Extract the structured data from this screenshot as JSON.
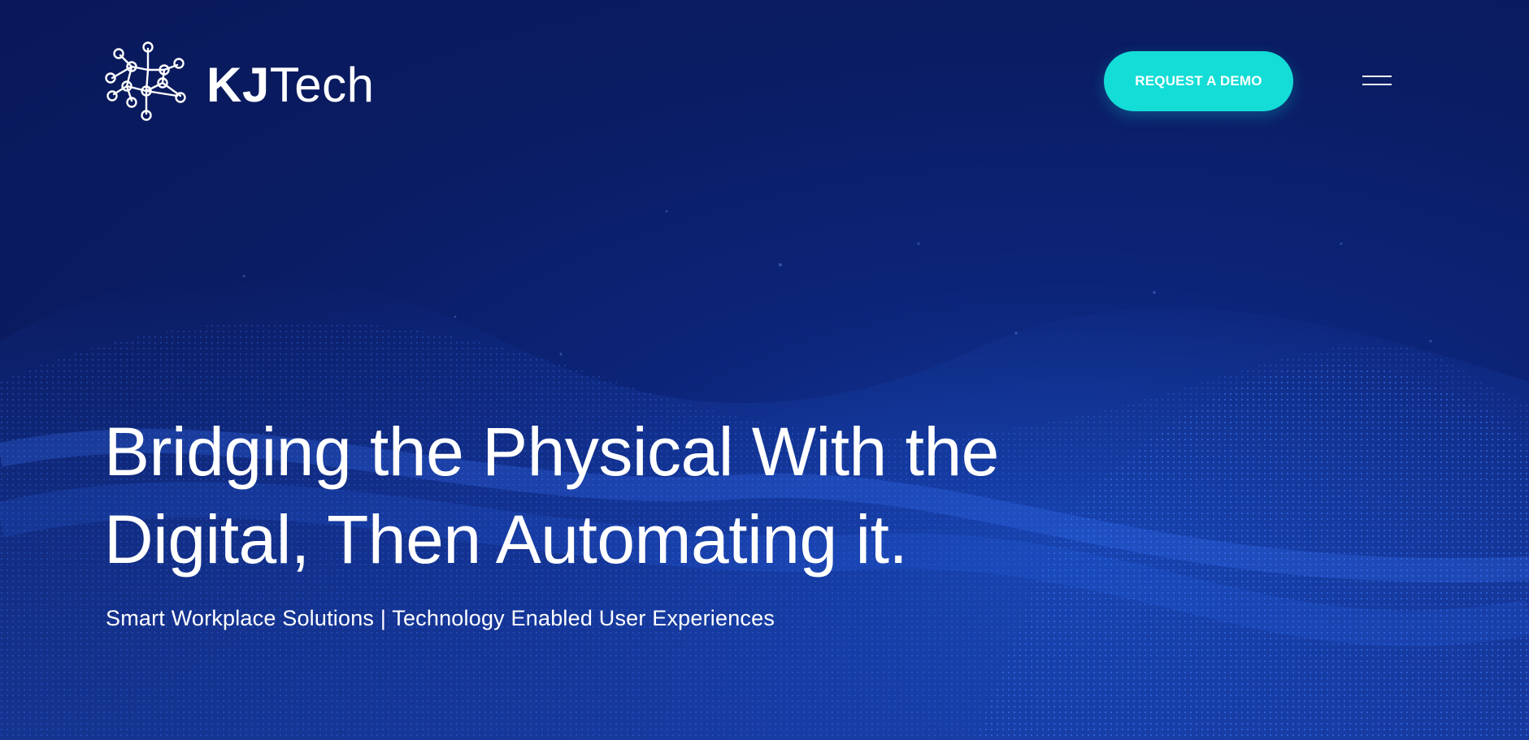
{
  "brand": {
    "name_bold": "KJ",
    "name_light": "Tech"
  },
  "header": {
    "demo_button_label": "REQUEST A DEMO",
    "menu_icon": "hamburger-menu-icon"
  },
  "hero": {
    "headline_line1": "Bridging the Physical With the",
    "headline_line2": "Digital, Then Automating it.",
    "subheadline": "Smart Workplace Solutions | Technology Enabled User Experiences"
  },
  "colors": {
    "background": "#0a1c63",
    "accent": "#14dcd6",
    "text": "#ffffff"
  }
}
